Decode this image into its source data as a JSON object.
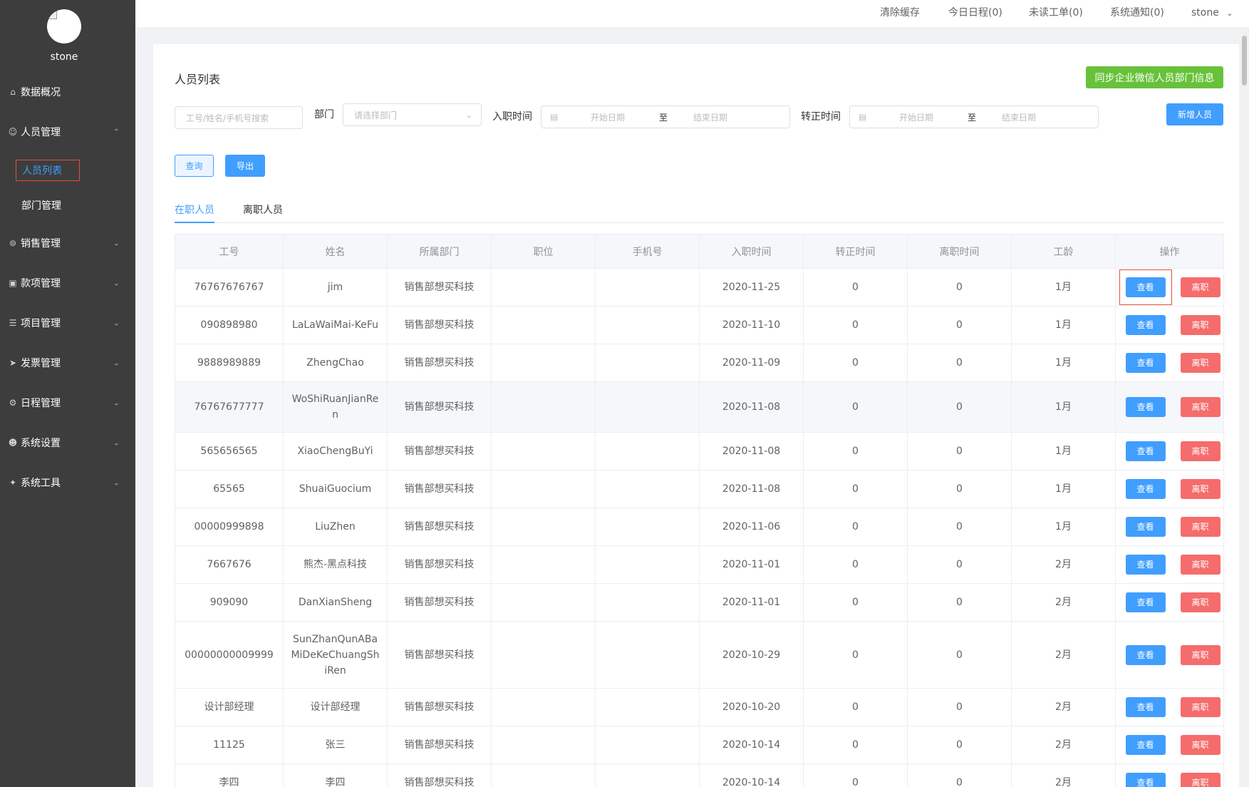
{
  "sidebar": {
    "username": "stone",
    "menu": [
      {
        "label": "数据概况",
        "icon": "home-icon"
      },
      {
        "label": "人员管理",
        "icon": "user-icon"
      },
      {
        "label": "销售管理",
        "icon": "cart-icon"
      },
      {
        "label": "款项管理",
        "icon": "money-icon"
      },
      {
        "label": "项目管理",
        "icon": "list-icon"
      },
      {
        "label": "发票管理",
        "icon": "send-icon"
      },
      {
        "label": "日程管理",
        "icon": "gear-icon"
      },
      {
        "label": "系统设置",
        "icon": "users-icon"
      },
      {
        "label": "系统工具",
        "icon": "wrench-icon"
      }
    ],
    "submenu": [
      {
        "label": "人员列表"
      },
      {
        "label": "部门管理"
      }
    ]
  },
  "topbar": {
    "clear_cache": "清除缓存",
    "today_schedule": "今日日程(0)",
    "unread_tickets": "未读工单(0)",
    "notifications": "系统通知(0)",
    "user": "stone"
  },
  "page": {
    "title": "人员列表",
    "sync_button": "同步企业微信人员部门信息",
    "add_button": "新增人员",
    "query_button": "查询",
    "export_button": "导出"
  },
  "filters": {
    "search_placeholder": "工号/姓名/手机号搜索",
    "dept_label": "部门",
    "dept_placeholder": "请选择部门",
    "join_label": "入职时间",
    "confirm_label": "转正时间",
    "start_placeholder": "开始日期",
    "end_placeholder": "结束日期",
    "range_sep": "至"
  },
  "tabs": [
    {
      "label": "在职人员",
      "active": true
    },
    {
      "label": "离职人员",
      "active": false
    }
  ],
  "table": {
    "columns": [
      "工号",
      "姓名",
      "所属部门",
      "职位",
      "手机号",
      "入职时间",
      "转正时间",
      "离职时间",
      "工龄",
      "操作"
    ],
    "view_label": "查看",
    "leave_label": "离职",
    "rows": [
      {
        "id": "76767676767",
        "name": "jim",
        "dept": "销售部想买科技",
        "position": "",
        "phone": "",
        "join": "2020-11-25",
        "confirm": "0",
        "leave": "0",
        "tenure": "1月"
      },
      {
        "id": "090898980",
        "name": "LaLaWaiMai-KeFu",
        "dept": "销售部想买科技",
        "position": "",
        "phone": "",
        "join": "2020-11-10",
        "confirm": "0",
        "leave": "0",
        "tenure": "1月"
      },
      {
        "id": "9888989889",
        "name": "ZhengChao",
        "dept": "销售部想买科技",
        "position": "",
        "phone": "",
        "join": "2020-11-09",
        "confirm": "0",
        "leave": "0",
        "tenure": "1月"
      },
      {
        "id": "76767677777",
        "name": "WoShiRuanJianRen",
        "dept": "销售部想买科技",
        "position": "",
        "phone": "",
        "join": "2020-11-08",
        "confirm": "0",
        "leave": "0",
        "tenure": "1月"
      },
      {
        "id": "565656565",
        "name": "XiaoChengBuYi",
        "dept": "销售部想买科技",
        "position": "",
        "phone": "",
        "join": "2020-11-08",
        "confirm": "0",
        "leave": "0",
        "tenure": "1月"
      },
      {
        "id": "65565",
        "name": "ShuaiGuocium",
        "dept": "销售部想买科技",
        "position": "",
        "phone": "",
        "join": "2020-11-08",
        "confirm": "0",
        "leave": "0",
        "tenure": "1月"
      },
      {
        "id": "00000999898",
        "name": "LiuZhen",
        "dept": "销售部想买科技",
        "position": "",
        "phone": "",
        "join": "2020-11-06",
        "confirm": "0",
        "leave": "0",
        "tenure": "1月"
      },
      {
        "id": "7667676",
        "name": "熊杰-黑点科技",
        "dept": "销售部想买科技",
        "position": "",
        "phone": "",
        "join": "2020-11-01",
        "confirm": "0",
        "leave": "0",
        "tenure": "2月"
      },
      {
        "id": "909090",
        "name": "DanXianSheng",
        "dept": "销售部想买科技",
        "position": "",
        "phone": "",
        "join": "2020-11-01",
        "confirm": "0",
        "leave": "0",
        "tenure": "2月"
      },
      {
        "id": "00000000009999",
        "name": "SunZhanQunABaMiDeKeChuangShiRen",
        "dept": "销售部想买科技",
        "position": "",
        "phone": "",
        "join": "2020-10-29",
        "confirm": "0",
        "leave": "0",
        "tenure": "2月"
      },
      {
        "id": "设计部经理",
        "name": "设计部经理",
        "dept": "销售部想买科技",
        "position": "",
        "phone": "",
        "join": "2020-10-20",
        "confirm": "0",
        "leave": "0",
        "tenure": "2月"
      },
      {
        "id": "11125",
        "name": "张三",
        "dept": "销售部想买科技",
        "position": "",
        "phone": "",
        "join": "2020-10-14",
        "confirm": "0",
        "leave": "0",
        "tenure": "2月"
      },
      {
        "id": "李四",
        "name": "李四",
        "dept": "销售部想买科技",
        "position": "",
        "phone": "",
        "join": "2020-10-14",
        "confirm": "0",
        "leave": "0",
        "tenure": "2月"
      }
    ]
  },
  "colors": {
    "sidebar_bg": "#3d3d3d",
    "primary": "#409eff",
    "success": "#67c23a",
    "danger": "#f56c6c",
    "highlight_border": "#e74c3c"
  }
}
